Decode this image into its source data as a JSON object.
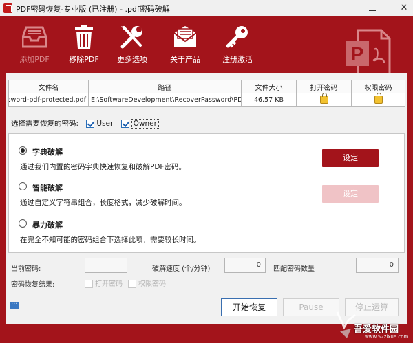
{
  "window": {
    "title": "PDF密码恢复-专业版 (已注册) - .pdf密码破解",
    "min_glyph": "—",
    "close_glyph": "✕"
  },
  "toolbar": {
    "items": [
      {
        "label": "添加PDF",
        "icon": "inbox-tray-icon",
        "enabled": false
      },
      {
        "label": "移除PDF",
        "icon": "trash-can-icon",
        "enabled": true
      },
      {
        "label": "更多选项",
        "icon": "tools-icon",
        "enabled": true
      },
      {
        "label": "关于产品",
        "icon": "envelope-icon",
        "enabled": true
      },
      {
        "label": "注册激活",
        "icon": "key-icon",
        "enabled": true
      }
    ],
    "logo_letter": "P"
  },
  "file_table": {
    "headers": [
      "文件名",
      "路径",
      "文件大小",
      "打开密码",
      "权限密码"
    ],
    "rows": [
      {
        "name": "password-pdf-protected.pdf",
        "path": "E:\\SoftwareDevelopment\\RecoverPassword\\PDF Password",
        "size": "46.57 KB"
      }
    ]
  },
  "select": {
    "label": "选择需要恢复的密码:",
    "user": {
      "label": "User",
      "checked": true
    },
    "owner": {
      "label": "Owner",
      "checked": true
    }
  },
  "methods": [
    {
      "title": "字典破解",
      "desc": "通过我们内置的密码字典快速恢复和破解PDF密码。",
      "selected": true,
      "button": "设定",
      "button_enabled": true
    },
    {
      "title": "智能破解",
      "desc": "通过自定义字符串组合，长度格式，减少破解时间。",
      "selected": false,
      "button": "设定",
      "button_enabled": false
    },
    {
      "title": "暴力破解",
      "desc": "在完全不知可能的密码组合下选择此项，需要较长时间。",
      "selected": false
    }
  ],
  "stats": {
    "current_label": "当前密码:",
    "current_value": "",
    "speed_label": "破解速度 (个/分钟)",
    "speed_value": "0",
    "match_label": "匹配密码数量",
    "match_value": "0",
    "result_label": "密码恢复结果:",
    "result_open": "打开密码",
    "result_perm": "权限密码"
  },
  "actions": {
    "start": "开始恢复",
    "pause": "Pause",
    "stop": "停止运算"
  },
  "colors": {
    "brand_red": "#a3141b",
    "set_disabled": "#f0c3c6"
  },
  "watermark": {
    "text": "吾爱软件园",
    "url": "www.52zixue.com"
  }
}
